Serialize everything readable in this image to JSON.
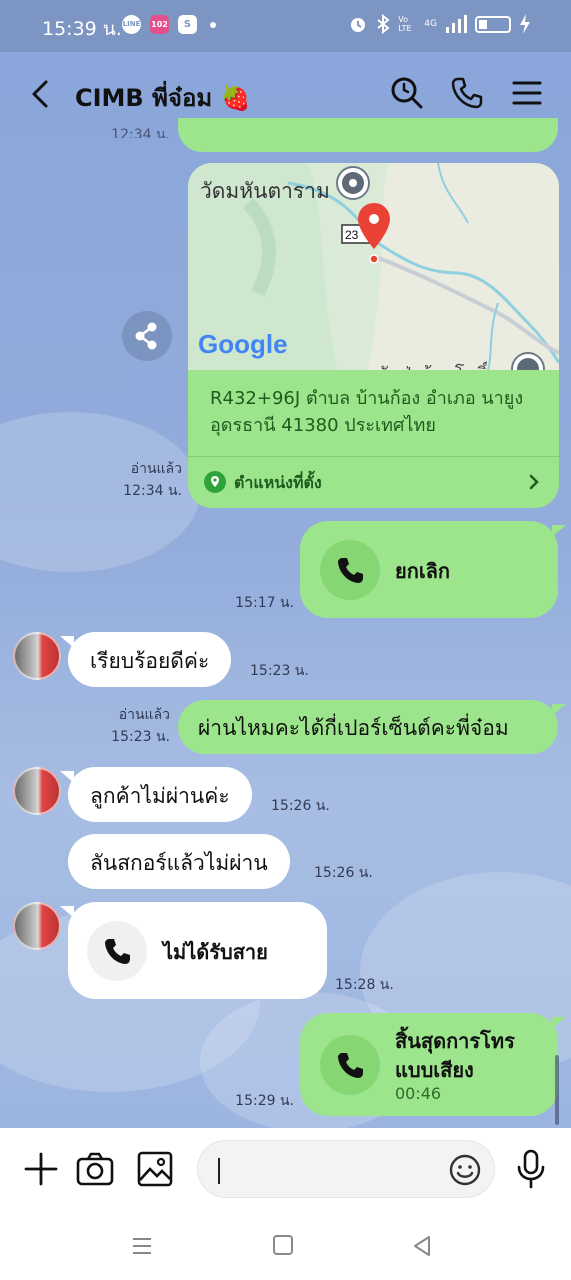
{
  "status_bar": {
    "time": "15:39 น.",
    "line_chip": "LINE",
    "app_chip": "102",
    "s_chip": "S",
    "volte": "Vo LTE",
    "network": "4G"
  },
  "header": {
    "title": "CIMB พี่จ๋อม 🍓"
  },
  "top_partial_time": "12:34 น.",
  "map_message": {
    "map_place_label": "วัดมหันตาราม",
    "route_label": "23",
    "map_brand": "Google",
    "bottom_partial_label": "วัดป่าก้อมโพธิ์",
    "address": "R432+96J ตำบล บ้านก้อง อำเภอ นายูง อุดรธานี 41380 ประเทศไทย",
    "location_link": "ตำแหน่งที่ตั้ง",
    "read": "อ่านแล้ว",
    "time": "12:34 น."
  },
  "messages": [
    {
      "id": "m1",
      "type": "call",
      "side": "out",
      "label": "ยกเลิก",
      "time": "15:17 น."
    },
    {
      "id": "m2",
      "type": "text",
      "side": "in",
      "text": "เรียบร้อยดีค่ะ",
      "time": "15:23 น."
    },
    {
      "id": "m3",
      "type": "text",
      "side": "out",
      "text": "ผ่านไหมคะได้กี่เปอร์เซ็นต์คะพี่จ๋อม",
      "read": "อ่านแล้ว",
      "time": "15:23 น."
    },
    {
      "id": "m4",
      "type": "text",
      "side": "in",
      "text": "ลูกค้าไม่ผ่านค่ะ",
      "time": "15:26 น."
    },
    {
      "id": "m5",
      "type": "text",
      "side": "in",
      "text": "ลันสกอร์แล้วไม่ผ่าน",
      "time": "15:26 น."
    },
    {
      "id": "m6",
      "type": "call",
      "side": "in",
      "label": "ไม่ได้รับสาย",
      "time": "15:28 น."
    },
    {
      "id": "m7",
      "type": "call",
      "side": "out",
      "label": "สิ้นสุดการโทร\nแบบเสียง",
      "label_line1": "สิ้นสุดการโทร",
      "label_line2": "แบบเสียง",
      "duration": "00:46",
      "time": "15:29 น."
    }
  ],
  "colors": {
    "green_bubble": "#9de58c",
    "white_bubble": "#ffffff",
    "chat_bg": "#8fa9d9",
    "header_bg": "#7d95c2"
  }
}
